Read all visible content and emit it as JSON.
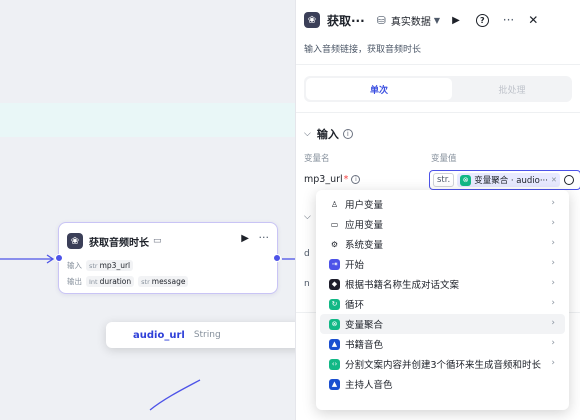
{
  "node": {
    "title": "获取音频时长",
    "input_label": "输入",
    "input_type": "str",
    "input_name": "mp3_url",
    "output_label": "输出",
    "output_fields": [
      {
        "type": "Int",
        "name": "duration"
      },
      {
        "type": "str",
        "name": "message"
      }
    ]
  },
  "suggestion": {
    "name": "audio_url",
    "type": "String"
  },
  "panel": {
    "title": "获取···",
    "env_label": "真实数据",
    "description": "输入音频链接，获取音频时长",
    "tabs": [
      "单次",
      "批处理"
    ],
    "input_section": "输入",
    "col_name": "变量名",
    "col_value": "变量值",
    "param_name": "mp3_url",
    "value_type": "str.",
    "value_chip": "变量聚合 · audio···"
  },
  "menu": {
    "items": [
      {
        "label": "用户变量",
        "icon": "user-icon",
        "kind": "outline"
      },
      {
        "label": "应用变量",
        "icon": "app-window-icon",
        "kind": "outline"
      },
      {
        "label": "系统变量",
        "icon": "gear-icon",
        "kind": "outline"
      },
      {
        "label": "开始",
        "icon": "start-icon",
        "kind": "box",
        "color": "#4d53e8"
      },
      {
        "label": "根据书籍名称生成对话文案",
        "icon": "llm-icon",
        "kind": "box",
        "color": "#1d1d2b"
      },
      {
        "label": "循环",
        "icon": "loop-icon",
        "kind": "box",
        "color": "#12b886"
      },
      {
        "label": "变量聚合",
        "icon": "variable-merge-icon",
        "kind": "box",
        "color": "#12b886",
        "highlighted": true
      },
      {
        "label": "书籍音色",
        "icon": "plugin-icon",
        "kind": "box",
        "color": "#1a4fd0"
      },
      {
        "label": "分割文案内容并创建3个循环来生成音频和时长",
        "icon": "code-icon",
        "kind": "box",
        "color": "#12b886"
      },
      {
        "label": "主持人音色",
        "icon": "plugin-icon",
        "kind": "box",
        "color": "#1a4fd0"
      }
    ]
  },
  "fragments": {
    "d": "d",
    "n": "n"
  }
}
